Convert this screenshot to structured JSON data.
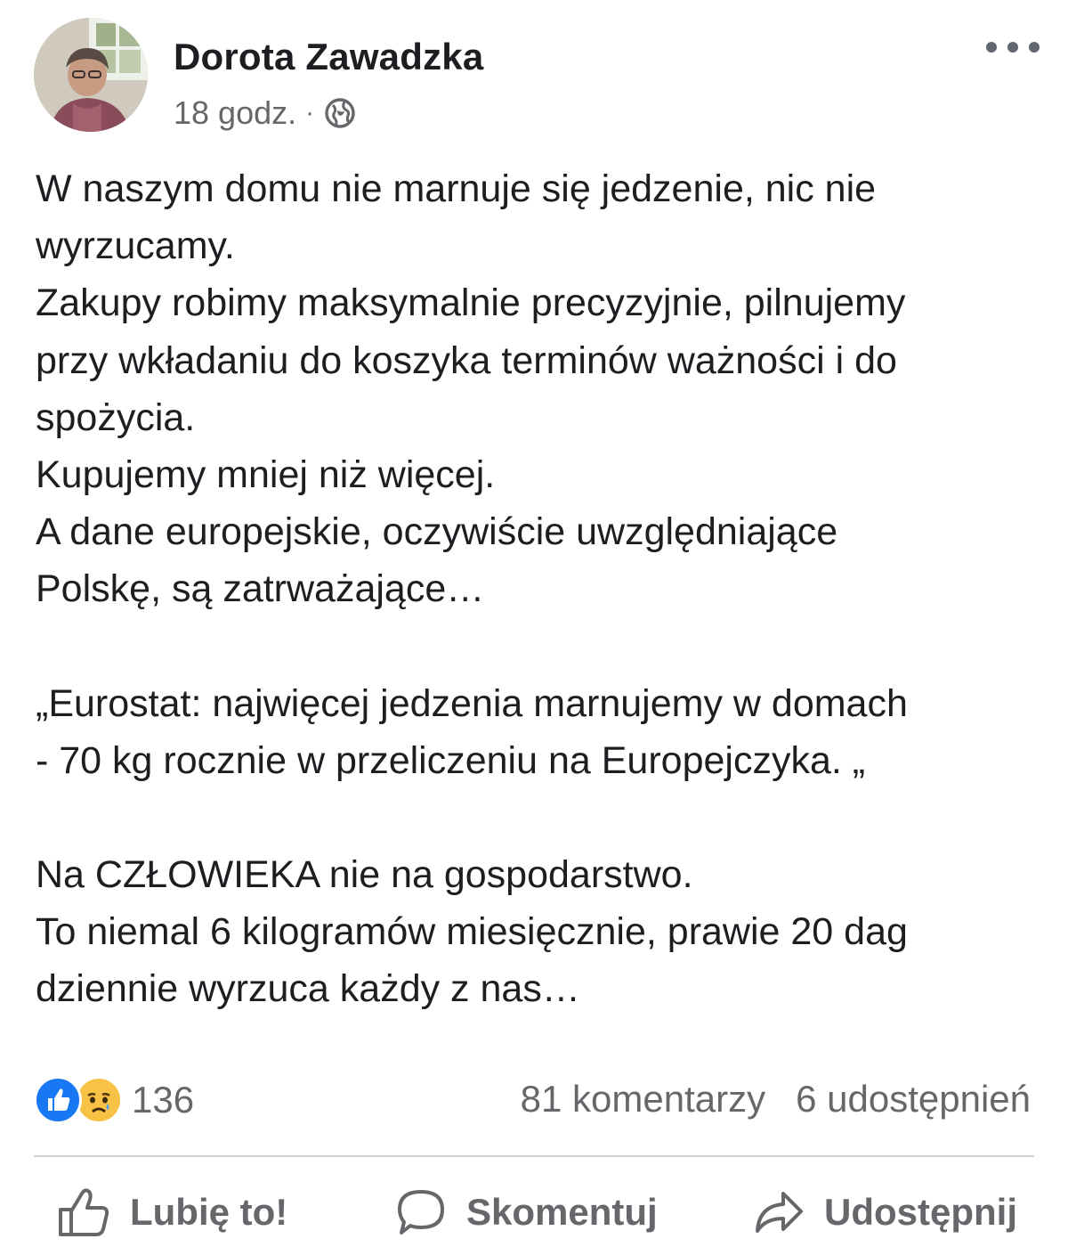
{
  "post": {
    "author": "Dorota Zawadzka",
    "time": "18 godz.",
    "separator": "·",
    "audience_icon": "globe-icon",
    "more_icon": "more-options-icon",
    "lines": [
      "W naszym domu nie marnuje się jedzenie, nic nie",
      "wyrzucamy.",
      "Zakupy robimy maksymalnie precyzyjnie, pilnujemy",
      "przy wkładaniu do koszyka terminów ważności i do",
      "spożycia.",
      "Kupujemy mniej niż więcej.",
      "A dane europejskie, oczywiście uwzględniające",
      "Polskę, są zatrważające…",
      "„Eurostat: najwięcej jedzenia marnujemy w domach",
      "- 70 kg rocznie w przeliczeniu na Europejczyka. „",
      "Na CZŁOWIEKA nie na gospodarstwo.",
      "To niemal 6 kilogramów miesięcznie, prawie 20 dag",
      "dziennie wyrzuca każdy z nas…"
    ]
  },
  "stats": {
    "reaction_icons": [
      "like-reaction-icon",
      "sad-reaction-icon"
    ],
    "reaction_count": "136",
    "comments": "81 komentarzy",
    "shares": "6 udostępnień"
  },
  "actions": {
    "like": "Lubię to!",
    "comment": "Skomentuj",
    "share": "Udostępnij"
  },
  "colors": {
    "text": "#1c1e21",
    "secondary": "#65676b",
    "like_blue": "#1877f2",
    "sad_yellow": "#f7c245",
    "divider": "#ced0d4"
  }
}
